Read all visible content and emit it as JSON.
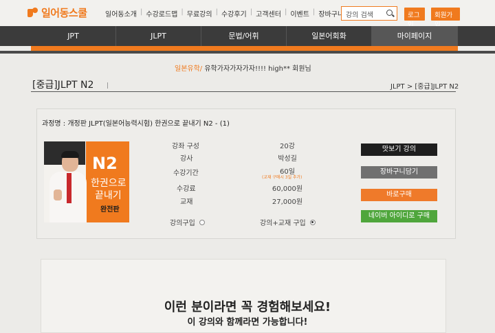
{
  "header": {
    "logo": "일어동스쿨",
    "nav": [
      "일어동소개",
      "수강로드맵",
      "무료강의",
      "수강후기",
      "고객센터",
      "이벤트",
      "장바구니"
    ],
    "search_placeholder": "강의 검색",
    "login": "로그인",
    "join": "회원가입"
  },
  "mainnav": [
    "JPT",
    "JLPT",
    "문법/어휘",
    "일본어회화",
    "마이페이지"
  ],
  "member": {
    "prefix": "일본유학/",
    "text": "유학가자가자가자!!!! high** 회원님"
  },
  "page": {
    "title": "[중급]JLPT N2",
    "breadcrumb": "JLPT > [중급]JLPT N2"
  },
  "course": {
    "name": "과정명 : 개정판 JLPT(일본어능력시험) 한권으로 끝내기 N2 - (1)",
    "thumb": {
      "big": "N2",
      "line1": "한권으로",
      "line2": "끝내기",
      "line3": "완전판"
    },
    "rows": [
      {
        "label": "강좌 구성",
        "value": "20강"
      },
      {
        "label": "강사",
        "value": "박성길"
      },
      {
        "label": "수강기간",
        "value": "60일"
      },
      {
        "label": "수강료",
        "value": "60,000원"
      },
      {
        "label": "교재",
        "value": "27,000원"
      }
    ],
    "period_note": "(교재 구매시 3일 추가)",
    "options": [
      "강의구입",
      "강의+교재 구입"
    ],
    "buttons": {
      "preview": "맛보기 강의",
      "cart": "장바구니담기",
      "buy": "바로구매",
      "naver": "네이버 아이디로 구매"
    }
  },
  "promo": {
    "headline": "이런 분이라면 꼭 경험해보세요!",
    "subline": "이 강의와 함께라면 가능합니다!"
  },
  "colors": {
    "accent": "#f07a1e",
    "nav": "#3b3b3b",
    "naver": "#4fa63c"
  }
}
